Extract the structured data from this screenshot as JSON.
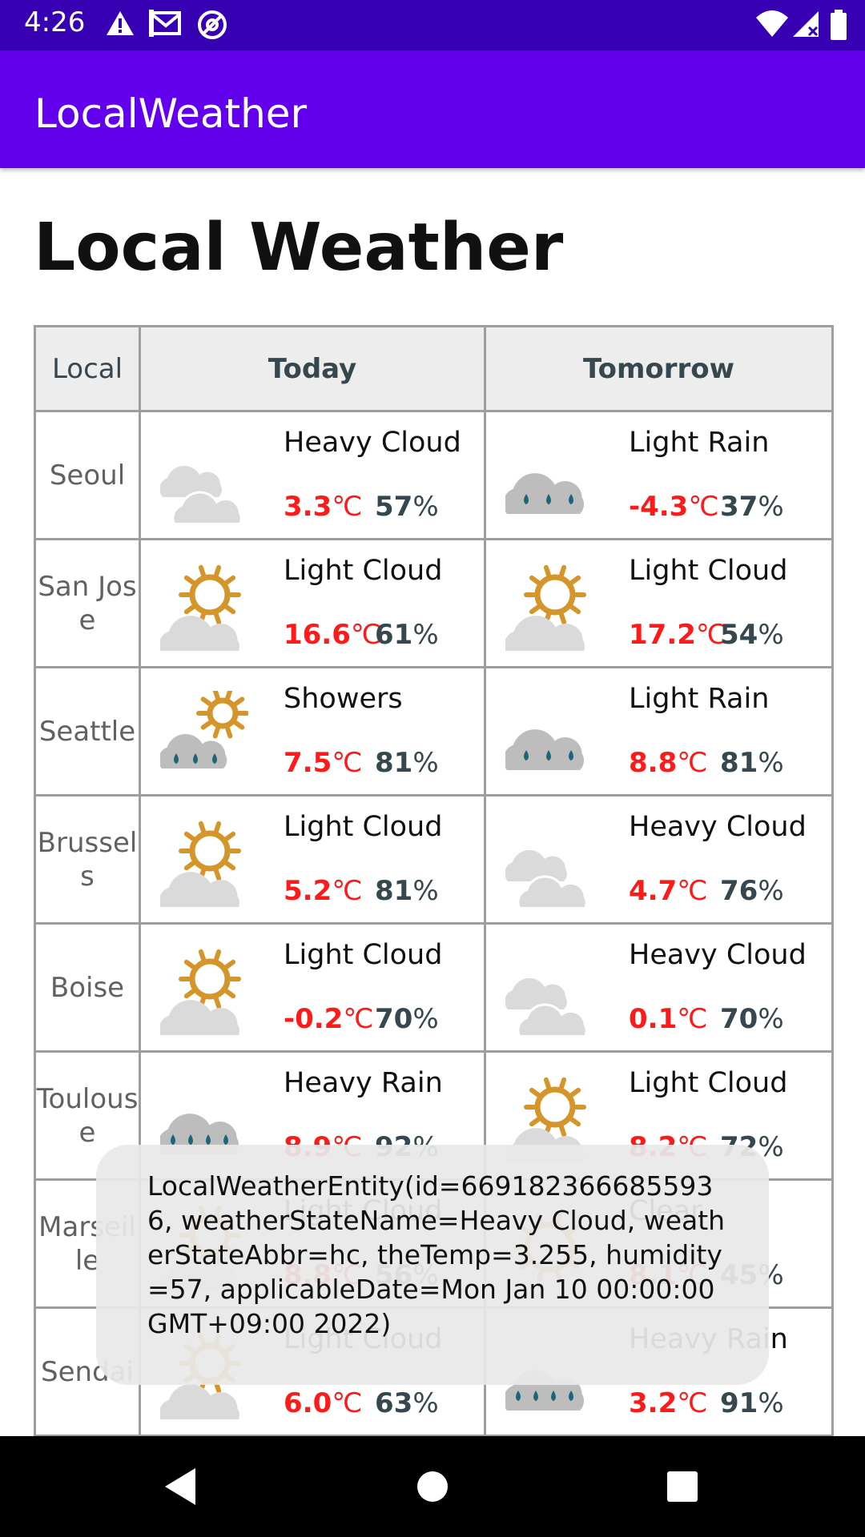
{
  "status_bar": {
    "time": "4:26",
    "icons": [
      "alert-icon",
      "gmail-icon",
      "at-sign-icon",
      "wifi-icon",
      "signal-icon",
      "battery-icon"
    ]
  },
  "app_bar": {
    "title": "LocalWeather"
  },
  "page": {
    "heading": "Local Weather"
  },
  "table": {
    "headers": {
      "local": "Local",
      "today": "Today",
      "tomorrow": "Tomorrow"
    },
    "rows": [
      {
        "city": "Seoul",
        "today": {
          "state": "Heavy Cloud",
          "icon": "heavy-cloud",
          "temp": "3.3",
          "humidity": "57"
        },
        "tomorrow": {
          "state": "Light Rain",
          "icon": "light-rain",
          "temp": "-4.3",
          "humidity": "37"
        }
      },
      {
        "city": "San Jose",
        "today": {
          "state": "Light Cloud",
          "icon": "light-cloud",
          "temp": "16.6",
          "humidity": "61"
        },
        "tomorrow": {
          "state": "Light Cloud",
          "icon": "light-cloud",
          "temp": "17.2",
          "humidity": "54"
        }
      },
      {
        "city": "Seattle",
        "today": {
          "state": "Showers",
          "icon": "showers",
          "temp": "7.5",
          "humidity": "81"
        },
        "tomorrow": {
          "state": "Light Rain",
          "icon": "light-rain",
          "temp": "8.8",
          "humidity": "81"
        }
      },
      {
        "city": "Brussels",
        "today": {
          "state": "Light Cloud",
          "icon": "light-cloud",
          "temp": "5.2",
          "humidity": "81"
        },
        "tomorrow": {
          "state": "Heavy Cloud",
          "icon": "heavy-cloud",
          "temp": "4.7",
          "humidity": "76"
        }
      },
      {
        "city": "Boise",
        "today": {
          "state": "Light Cloud",
          "icon": "light-cloud",
          "temp": "-0.2",
          "humidity": "70"
        },
        "tomorrow": {
          "state": "Heavy Cloud",
          "icon": "heavy-cloud",
          "temp": "0.1",
          "humidity": "70"
        }
      },
      {
        "city": "Toulouse",
        "today": {
          "state": "Heavy Rain",
          "icon": "heavy-rain",
          "temp": "8.9",
          "humidity": "92"
        },
        "tomorrow": {
          "state": "Light Cloud",
          "icon": "light-cloud",
          "temp": "8.2",
          "humidity": "72"
        }
      },
      {
        "city": "Marseille",
        "today": {
          "state": "Light Cloud",
          "icon": "light-cloud",
          "temp": "8.8",
          "humidity": "56"
        },
        "tomorrow": {
          "state": "Clear",
          "icon": "clear",
          "temp": "8.1",
          "humidity": "45"
        }
      },
      {
        "city": "Sendai",
        "today": {
          "state": "Light Cloud",
          "icon": "light-cloud",
          "temp": "6.0",
          "humidity": "63"
        },
        "tomorrow": {
          "state": "Heavy Rain",
          "icon": "heavy-rain",
          "temp": "3.2",
          "humidity": "91"
        }
      }
    ],
    "temp_unit": "℃",
    "humidity_unit": "%"
  },
  "toast": {
    "text": "LocalWeatherEntity(id=6691823666855936, weatherStateName=Heavy Cloud, weatherStateAbbr=hc, theTemp=3.255, humidity=57, applicableDate=Mon Jan 10 00:00:00 GMT+09:00 2022)"
  },
  "nav_bar": {
    "buttons": [
      "back-icon",
      "home-icon",
      "recents-icon"
    ]
  },
  "colors": {
    "status_bar": "#3700b3",
    "app_bar": "#6200ee",
    "temperature": "#ff1a1a",
    "humidity": "#37474f",
    "sun": "#d4952b",
    "cloud_light": "#dadada",
    "cloud_dark": "#bdbdbd",
    "rain": "#1e6479"
  }
}
